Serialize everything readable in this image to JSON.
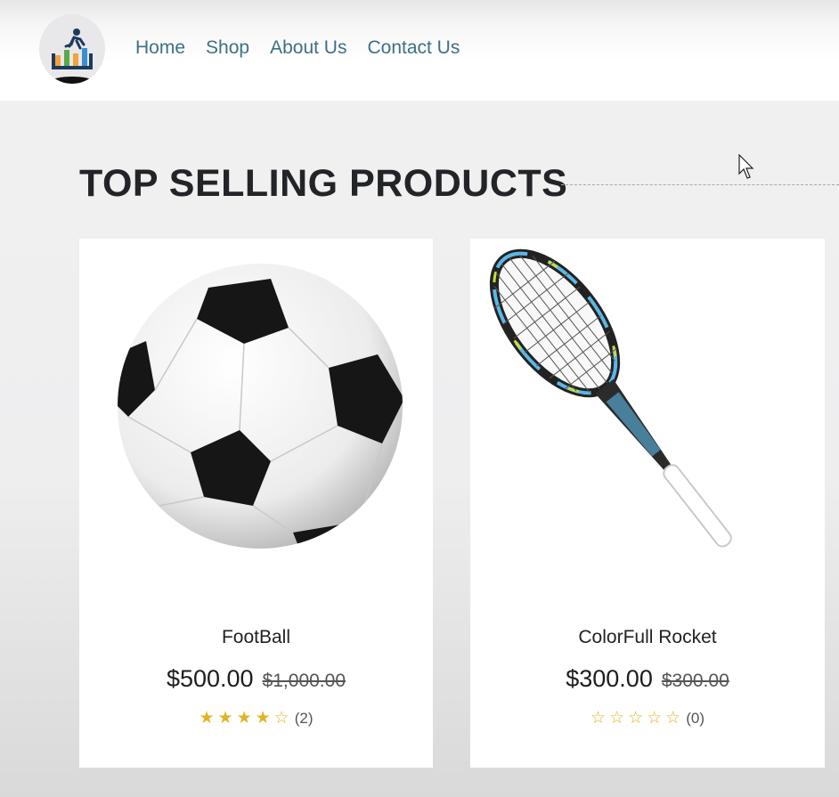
{
  "nav": {
    "items": [
      "Home",
      "Shop",
      "About Us",
      "Contact Us"
    ]
  },
  "section": {
    "title": "TOP SELLING PRODUCTS"
  },
  "products": [
    {
      "name": "FootBall",
      "price": "$500.00",
      "old_price": "$1,000.00",
      "rating": 4,
      "max_rating": 5,
      "reviews": "(2)",
      "image": "soccer-ball"
    },
    {
      "name": "ColorFull Rocket",
      "price": "$300.00",
      "old_price": "$300.00",
      "rating": 0,
      "max_rating": 5,
      "reviews": "(0)",
      "image": "squash-racket"
    }
  ],
  "colors": {
    "nav": "#3f6f86",
    "star": "#e3b324",
    "title": "#222428"
  },
  "icons": {
    "logo": "runner-chart-logo",
    "cursor": "mouse-pointer-icon",
    "star_filled": "★",
    "star_empty": "☆"
  }
}
